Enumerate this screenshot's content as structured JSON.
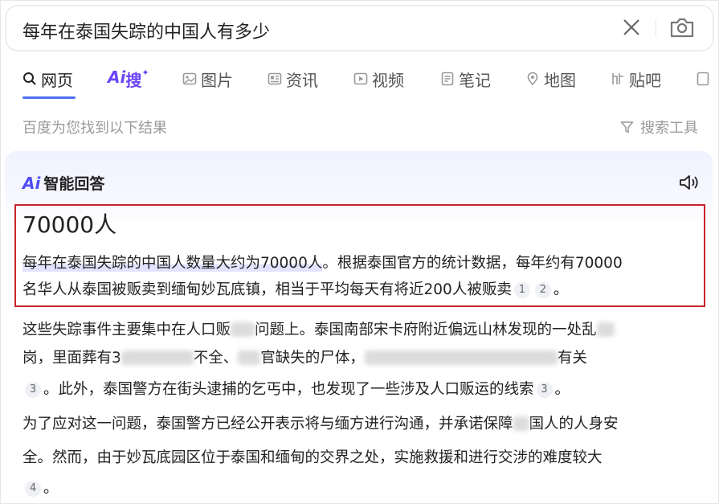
{
  "search": {
    "query": "每年在泰国失踪的中国人有多少"
  },
  "tabs": [
    {
      "label": "网页",
      "icon": "search-icon"
    },
    {
      "label": "搜",
      "prefix": "Ai",
      "icon": "ai-icon"
    },
    {
      "label": "图片",
      "icon": "image-icon"
    },
    {
      "label": "资讯",
      "icon": "news-icon"
    },
    {
      "label": "视频",
      "icon": "video-icon"
    },
    {
      "label": "笔记",
      "icon": "note-icon"
    },
    {
      "label": "地图",
      "icon": "map-pin-icon"
    },
    {
      "label": "贴吧",
      "icon": "tieba-icon"
    }
  ],
  "results": {
    "count_text": "百度为您找到以下结果",
    "tools_label": "搜索工具"
  },
  "ai_answer": {
    "logo": "Ai",
    "title": "智能回答",
    "headline": "70000人",
    "line1_hl": "每年在泰国失踪的中国人数量大约为70000人",
    "line1_rest": "。根据泰国官方的统计数据，每年约有70000",
    "line2": "名华人从泰国被贩卖到缅甸妙瓦底镇，相当于平均每天有将近200人被贩卖",
    "line2_cites": [
      "1",
      "2"
    ],
    "line2_end": "。",
    "p2_l1a": "这些失踪事件主要集中在人口贩",
    "p2_l1b": "问题上。泰国南部宋卡府附近偏远山林发现的一处乱",
    "p2_l2a": "岗，里面葬有3",
    "p2_l2b": "不全、",
    "p2_l2c": "官缺失的尸体，",
    "p2_l2d": "有关",
    "p2_l3_cite": "3",
    "p2_l3": "。此外，泰国警方在街头逮捕的乞丐中，也发现了一些涉及人口贩运的线索",
    "p2_l3_cite2": "3",
    "p2_l3_end": "。",
    "p3_l1a": "为了应对这一问题，泰国警方已经公开表示将与缅方进行沟通，并承诺保障",
    "p3_l1b": "国人的人身安",
    "p3_l2": "全。然而，由于妙瓦底园区位于泰国和缅甸的交界之处，实施救援和进行交涉的难度较大",
    "p3_l3_cite": "4",
    "p3_l3_end": "。"
  },
  "colors": {
    "accent": "#4e6ef2",
    "ai_purple": "#6a44f6",
    "highlight_border": "#c9242b"
  }
}
